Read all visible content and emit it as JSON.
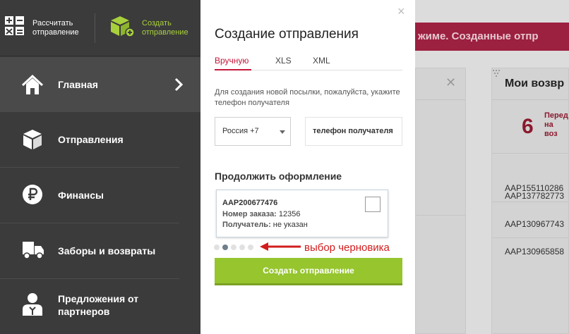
{
  "sidebar": {
    "top_actions": {
      "calculate_label": "Рассчитать\nотправление",
      "create_label": "Создать\nотправление"
    },
    "nav": [
      {
        "label": "Главная",
        "icon": "home-icon",
        "active": true
      },
      {
        "label": "Отправления",
        "icon": "box-icon",
        "active": false
      },
      {
        "label": "Финансы",
        "icon": "ruble-icon",
        "active": false
      },
      {
        "label": "Заборы и возвраты",
        "icon": "truck-icon",
        "active": false
      },
      {
        "label": "Предложения от\nпартнеров",
        "icon": "partner-icon",
        "active": false
      }
    ]
  },
  "background": {
    "banner_text": "жиме. Созданные отпр",
    "card_title": "Мои возвр",
    "count": "6",
    "count_caption": "Перед\nна воз",
    "codes": [
      "AAP155110286",
      "AAP137782773",
      "AAP130967743",
      "AAP130965858"
    ]
  },
  "modal": {
    "close": "×",
    "title": "Создание отправления",
    "tabs": [
      "Вручную",
      "XLS",
      "XML"
    ],
    "active_tab": "Вручную",
    "hint": "Для создания новой посылки, пожалуйста, укажите телефон получателя",
    "country_value": "Россия +7",
    "phone_placeholder": "телефон получателя",
    "continue_title": "Продолжить оформление",
    "draft": {
      "id": "AAP200677476",
      "order_label": "Номер заказа:",
      "order_value": "12356",
      "recipient_label": "Получатель:",
      "recipient_value": "не указан"
    },
    "pagination": {
      "count": 5,
      "active_index": 1
    },
    "create_button": "Создать отправление"
  },
  "annotation": {
    "text": "выбор черновика",
    "color": "#d11d1d"
  },
  "colors": {
    "accent_green": "#96c52e",
    "accent_red": "#c4183a",
    "sidebar_bg": "#3b3b3b"
  }
}
